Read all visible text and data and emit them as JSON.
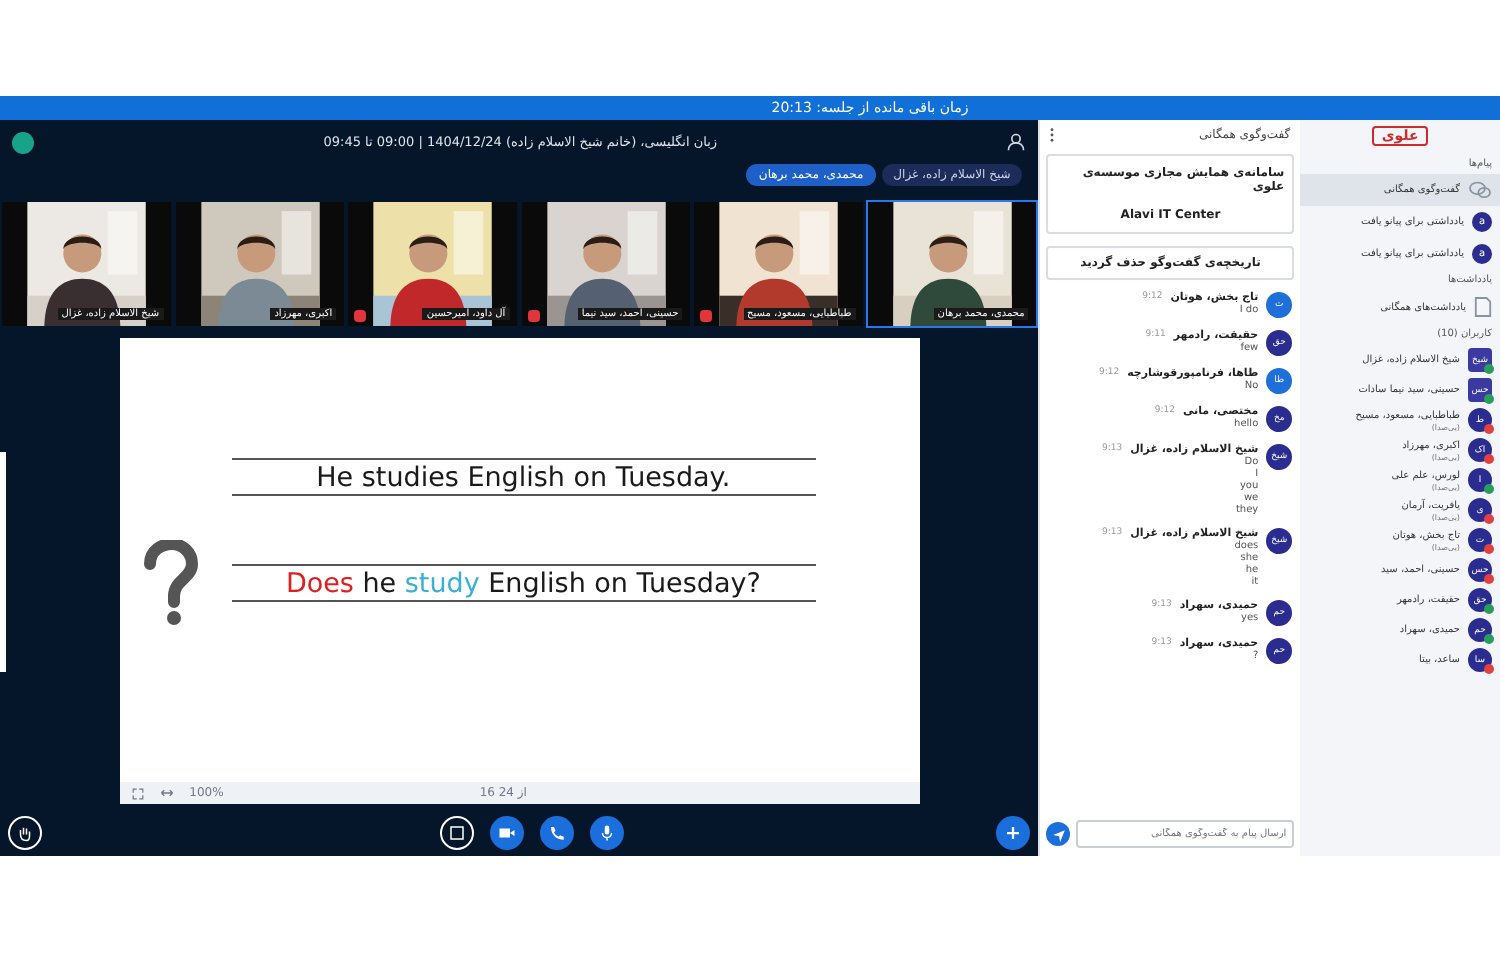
{
  "session_bar": {
    "text": "زمان باقی مانده از جلسه: 20:13"
  },
  "meeting": {
    "title": "زبان انگلیسی، (خانم شیخ الاسلام زاده) 1404/12/24 | 09:00 تا 09:45",
    "presenters": [
      {
        "name": "شیخ الاسلام زاده، غزال",
        "selected": false
      },
      {
        "name": "محمدی، محمد برهان",
        "selected": true
      }
    ]
  },
  "videos": [
    {
      "name": "محمدی، محمد برهان",
      "selected": true,
      "muted": false,
      "kind": "picture"
    },
    {
      "name": "طباطبایی، مسعود، مسیح",
      "selected": false,
      "muted": true,
      "kind": "picture"
    },
    {
      "name": "حسینی، احمد، سید نیما",
      "selected": false,
      "muted": true,
      "kind": "picture"
    },
    {
      "name": "آل داود، امیرحسین",
      "selected": false,
      "muted": true,
      "kind": "picture"
    },
    {
      "name": "اکبری، مهرزاد",
      "selected": false,
      "muted": false,
      "kind": "picture"
    },
    {
      "name": "شیخ الاسلام زاده، غزال",
      "selected": false,
      "muted": false,
      "kind": "picture"
    }
  ],
  "slide": {
    "statement": "He studies English on Tuesday.",
    "question": {
      "auxiliary": {
        "text": "Does",
        "color": "#e02020"
      },
      "subject": "he",
      "verb": {
        "text": "study",
        "color": "#3ab0d8"
      },
      "rest": "English on Tuesday?"
    },
    "zoom": "100%",
    "page": "16 از 24"
  },
  "chat": {
    "title": "گفت‌وگوی همگانی",
    "welcome": "سامانه‌ی همایش مجازی موسسه‌ی علوی",
    "welcome_sub": "Alavi IT Center",
    "notice": "تاریخچه‌ی گفت‌وگو حذف گردید",
    "messages": [
      {
        "initials": "ت",
        "color": "#1e6fd9",
        "name": "تاج بخش، هوتان",
        "time": "9:12",
        "lines": [
          "I do"
        ]
      },
      {
        "initials": "حق",
        "color": "#2a2d8f",
        "name": "حقیقت، رادمهر",
        "time": "9:11",
        "lines": [
          "few"
        ]
      },
      {
        "initials": "طا",
        "color": "#1e6fd9",
        "name": "طاها، فرنامپورقوشارچه",
        "time": "9:12",
        "lines": [
          "No"
        ]
      },
      {
        "initials": "مخ",
        "color": "#2a2d8f",
        "name": "مختصی، مانی",
        "time": "9:12",
        "lines": [
          "hello"
        ]
      },
      {
        "initials": "شیخ",
        "color": "#2a2d8f",
        "name": "شیخ الاسلام زاده، غزال",
        "time": "9:13",
        "lines": [
          "Do",
          "I",
          "you",
          "we",
          "they"
        ]
      },
      {
        "initials": "شیخ",
        "color": "#2a2d8f",
        "name": "شیخ الاسلام زاده، غزال",
        "time": "9:13",
        "lines": [
          "does",
          "she",
          "he",
          "it"
        ]
      },
      {
        "initials": "حم",
        "color": "#2a2d8f",
        "name": "حمیدی، سهراد",
        "time": "9:13",
        "lines": [
          "yes"
        ]
      },
      {
        "initials": "حم",
        "color": "#2a2d8f",
        "name": "حمیدی، سهراد",
        "time": "9:13",
        "lines": [
          "?"
        ]
      }
    ],
    "placeholder": "ارسال پیام به گفت‌وگوی همگانی"
  },
  "sidebar": {
    "logo": "علوی",
    "messages_heading": "پیام‌ها",
    "chats": [
      {
        "label": "گفت‌وگوی همگانی",
        "selected": true,
        "kind": "public"
      },
      {
        "label": "یادداشتی برای پیانو یافت",
        "selected": false,
        "kind": "private",
        "initials": "a"
      },
      {
        "label": "یادداشتی برای پیانو یافت",
        "selected": false,
        "kind": "private",
        "initials": "a"
      }
    ],
    "notes_heading": "یادداشت‌ها",
    "notes": [
      {
        "label": "یادداشت‌های همگانی"
      }
    ],
    "users_heading": "کاربران (10)",
    "users": [
      {
        "initials": "شیخ",
        "name": "شیخ الاسلام زاده، غزال",
        "color": "#2a9d5c",
        "square": true
      },
      {
        "initials": "حس",
        "name": "حسینی، سید نیما سادات",
        "color": "#2a9d5c",
        "square": true
      },
      {
        "initials": "ط",
        "name": "طباطبایی، مسعود، مسیح",
        "status": "(بی‌صدا)",
        "color": "#e04040",
        "square": false
      },
      {
        "initials": "اک",
        "name": "اکبری، مهرزاد",
        "status": "(بی‌صدا)",
        "color": "#e04040",
        "square": false
      },
      {
        "initials": "ا",
        "name": "لورس، علم علی",
        "status": "(بی‌صدا)",
        "color": "#2a9d5c",
        "square": false
      },
      {
        "initials": "ی",
        "name": "یافریت، آرمان",
        "status": "(بی‌صدا)",
        "color": "#e04040",
        "square": false
      },
      {
        "initials": "ت",
        "name": "تاج بخش، هوتان",
        "status": "(بی‌صدا)",
        "color": "#e04040",
        "square": false
      },
      {
        "initials": "حس",
        "name": "حسینی، احمد، سید",
        "color": "#e04040",
        "square": false
      },
      {
        "initials": "حق",
        "name": "حقیقت، رادمهر",
        "color": "#2a9d5c",
        "square": false
      },
      {
        "initials": "حم",
        "name": "حمیدی، سهراد",
        "color": "#2a9d5c",
        "square": false
      },
      {
        "initials": "سا",
        "name": "ساعد، بیتا",
        "color": "#e04040",
        "square": false
      }
    ]
  }
}
